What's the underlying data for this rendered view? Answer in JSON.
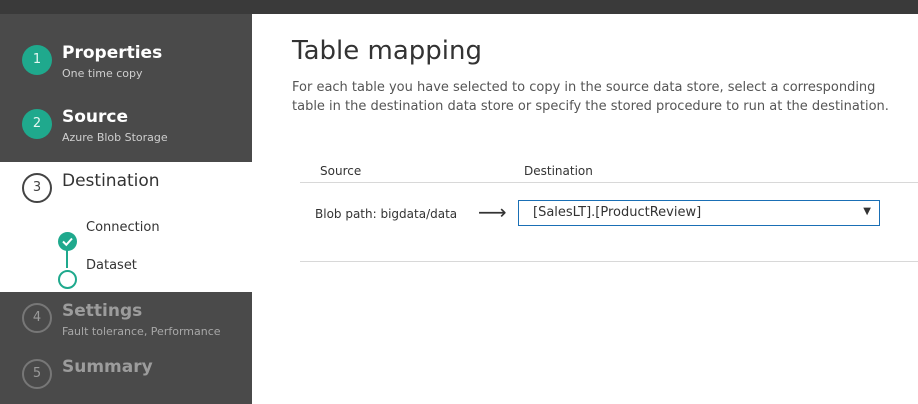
{
  "sidebar": {
    "steps": [
      {
        "number": "1",
        "title": "Properties",
        "subtitle": "One time copy",
        "state": "done"
      },
      {
        "number": "2",
        "title": "Source",
        "subtitle": "Azure Blob Storage",
        "state": "done"
      },
      {
        "number": "3",
        "title": "Destination",
        "subtitle": "",
        "state": "current"
      },
      {
        "number": "4",
        "title": "Settings",
        "subtitle": "Fault tolerance, Performance",
        "state": "pending"
      },
      {
        "number": "5",
        "title": "Summary",
        "subtitle": "",
        "state": "pending"
      }
    ],
    "substeps": [
      {
        "label": "Connection",
        "state": "done"
      },
      {
        "label": "Dataset",
        "state": "current"
      }
    ]
  },
  "main": {
    "title": "Table mapping",
    "description": "For each table you have selected to copy in the source data store, select a corresponding table in the destination data store or specify the stored procedure to run at the destination.",
    "columns": {
      "source": "Source",
      "destination": "Destination"
    },
    "rows": [
      {
        "source": "Blob path: bigdata/data",
        "destination": "[SalesLT].[ProductReview]"
      }
    ]
  },
  "colors": {
    "accent": "#1fa98d",
    "sidebar_dark": "#4a4a4a",
    "select_border": "#1a6fb5"
  },
  "icons": {
    "arrow": "right-arrow-icon",
    "caret": "dropdown-caret-icon",
    "check": "checkmark-icon"
  }
}
